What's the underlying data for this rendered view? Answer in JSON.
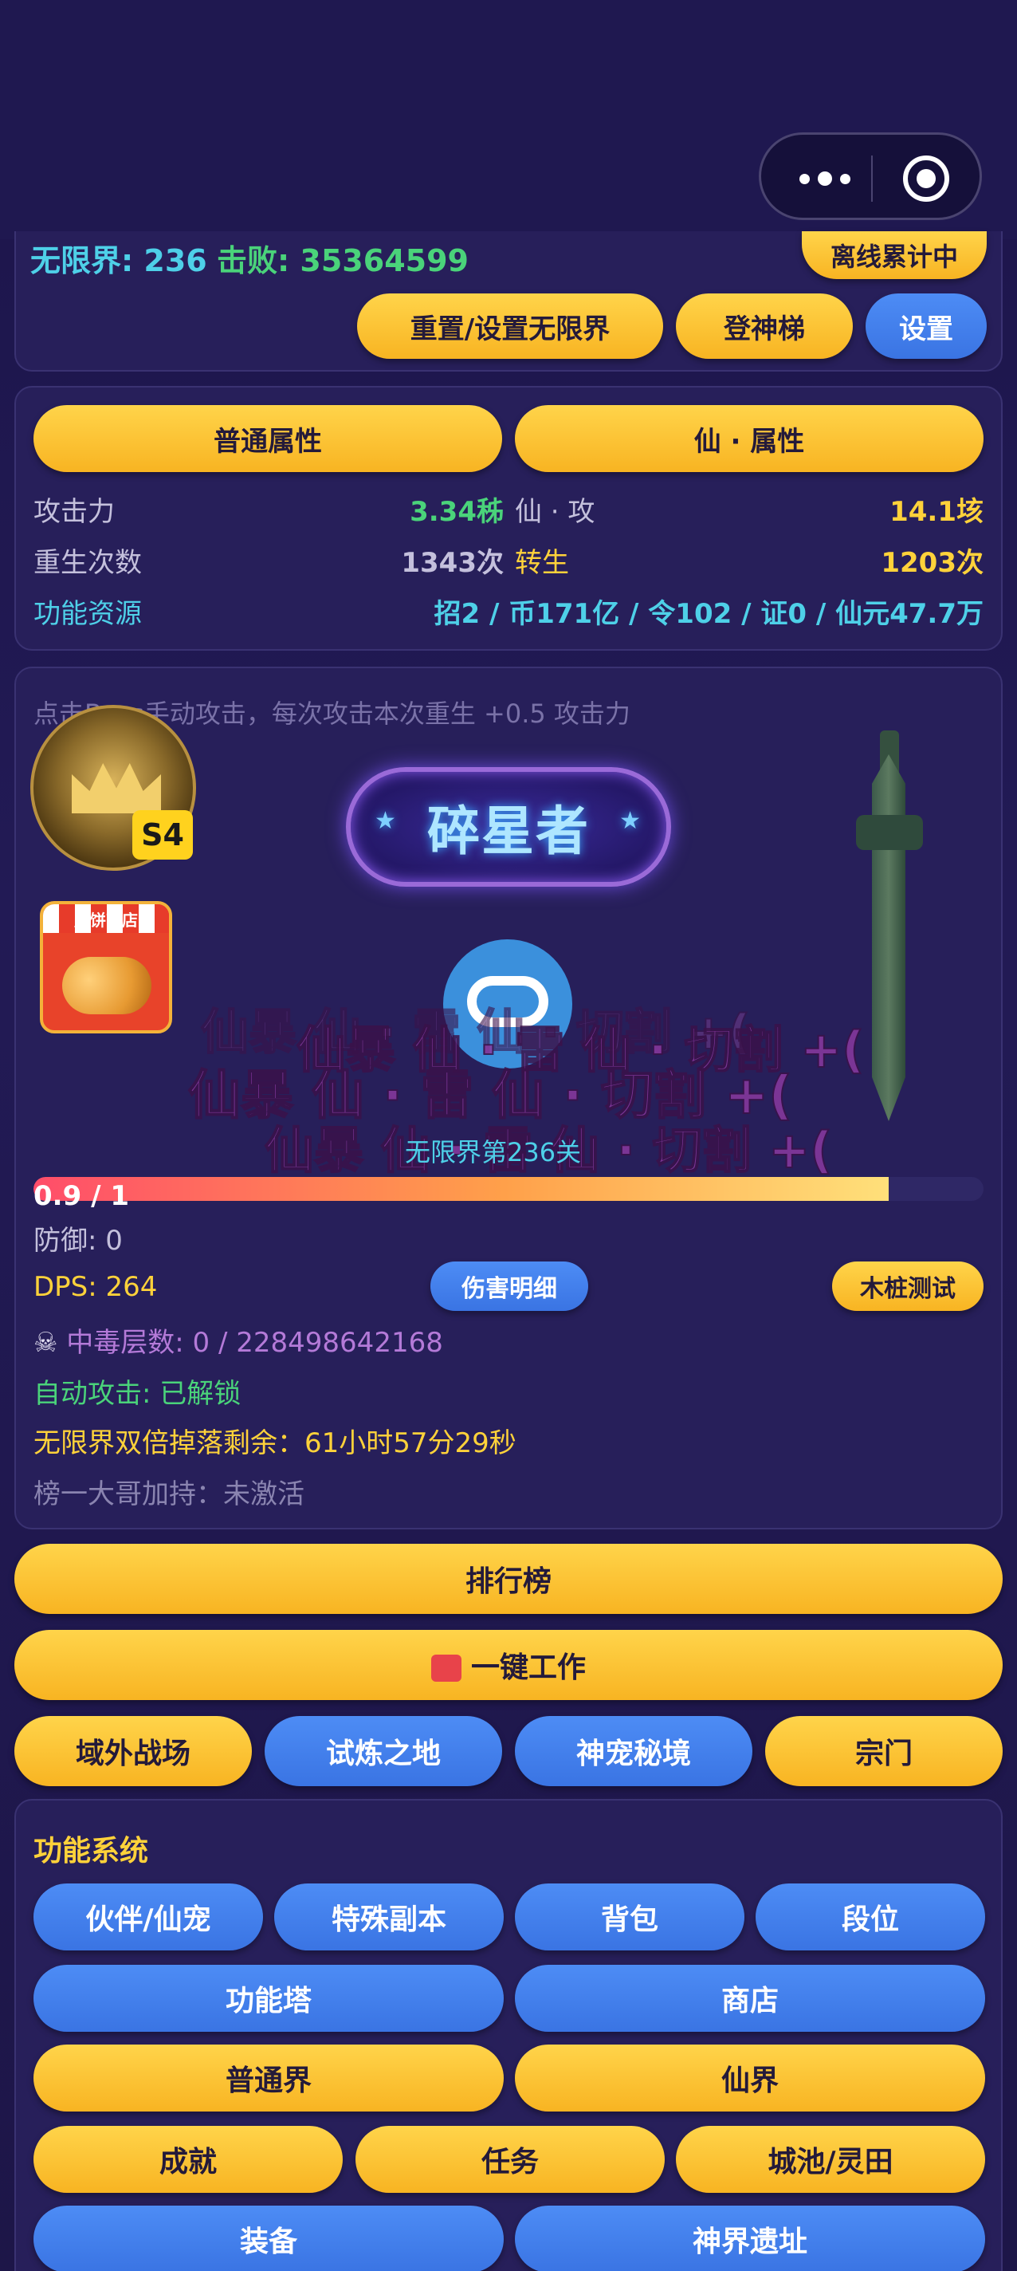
{
  "header": {
    "more_icon": "more-dots-icon",
    "close_icon": "target-icon"
  },
  "status": {
    "wuxian_label": "无限界: 236",
    "defeat_label": "击败: 35364599",
    "offline_badge": "离线累计中",
    "buttons": {
      "reset": "重置/设置无限界",
      "ladder": "登神梯",
      "settings": "设置"
    }
  },
  "attributes": {
    "tab_normal": "普通属性",
    "tab_xian": "仙 · 属性",
    "rows": [
      {
        "label": "攻击力",
        "value": "3.34秭",
        "label2": "仙 · 攻",
        "value2": "14.1垓"
      },
      {
        "label": "重生次数",
        "value": "1343次",
        "label2": "转生",
        "value2": "1203次"
      }
    ],
    "resource_label": "功能资源",
    "resource_value": "招2 / 币171亿 / 令102 / 证0 / 仙元47.7万"
  },
  "battle": {
    "hint": "点击Boss手动攻击，每次攻击本次重生 +0.5 攻击力",
    "season_badge": "S4",
    "shop_label": "月饼商店",
    "title_banner": "碎星者",
    "damage_texts": [
      "仙暴 仙 · 雷 仙 · 切割 +(",
      "仙暴 仙 · 雷 仙 · 切割 +(",
      "仙暴 仙 · 雷 仙 · 切割 +(",
      "仙暴 仙 · 雷 仙 · 切割 +("
    ],
    "stage_sub": "无限界第236关",
    "hp_text": "0.9 / 1",
    "hp_fraction": 0.9,
    "defense": "防御: 0",
    "dps": "DPS: 264",
    "damage_detail_button": "伤害明细",
    "dummy_test_button": "木桩测试",
    "poison": "中毒层数: 0 / 228498642168",
    "auto_attack": "自动攻击: 已解锁",
    "double_drop": "无限界双倍掉落剩余：61小时57分29秒",
    "top_bonus": "榜一大哥加持：未激活"
  },
  "nav": {
    "ranking": "排行榜",
    "one_click_work": "一键工作",
    "row": [
      "域外战场",
      "试炼之地",
      "神宠秘境",
      "宗门"
    ]
  },
  "systems": {
    "title": "功能系统",
    "row1": [
      "伙伴/仙宠",
      "特殊副本",
      "背包",
      "段位"
    ],
    "row2": [
      "功能塔",
      "商店"
    ],
    "row3": [
      "普通界",
      "仙界"
    ],
    "row4": [
      "成就",
      "任务",
      "城池/灵田"
    ],
    "row5": [
      "装备",
      "神界遗址"
    ]
  },
  "colors": {
    "gold": "#f8b422",
    "blue": "#3a74e3",
    "green": "#4ad37a",
    "cyan": "#4ed0e8",
    "yellow": "#ffd23a",
    "purple": "#b47ad8"
  }
}
